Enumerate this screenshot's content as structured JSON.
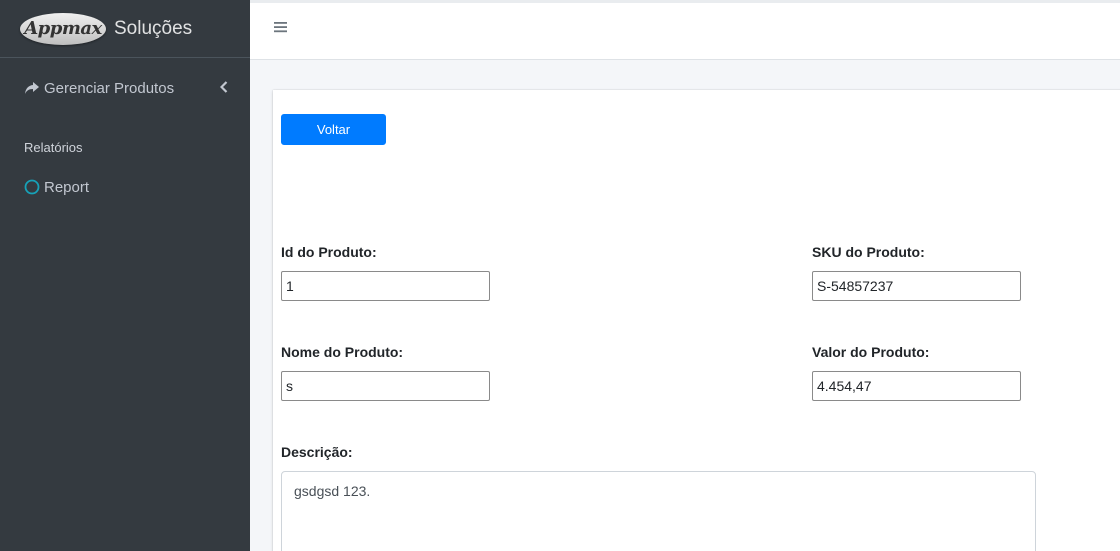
{
  "sidebar": {
    "logo_text": "Appmax",
    "brand_name": "Soluções",
    "menu_manage": {
      "label": "Gerenciar Produtos",
      "icon": "share-arrow-icon"
    },
    "section_header": "Relatórios",
    "menu_report": {
      "label": "Report",
      "icon": "circle-outline-icon",
      "icon_color": "#17a2b8"
    }
  },
  "navbar": {
    "menu_icon": "hamburger-icon"
  },
  "form": {
    "back_button": "Voltar",
    "id_label": "Id do Produto:",
    "id_value": "1",
    "sku_label": "SKU do Produto:",
    "sku_value": "S-54857237",
    "name_label": "Nome do Produto:",
    "name_value": "s",
    "price_label": "Valor do Produto:",
    "price_value": "4.454,47",
    "description_label": "Descrição:",
    "description_value": "gsdgsd 123."
  },
  "colors": {
    "sidebar_bg": "#343a40",
    "primary": "#007bff",
    "content_bg": "#f4f6f9"
  }
}
